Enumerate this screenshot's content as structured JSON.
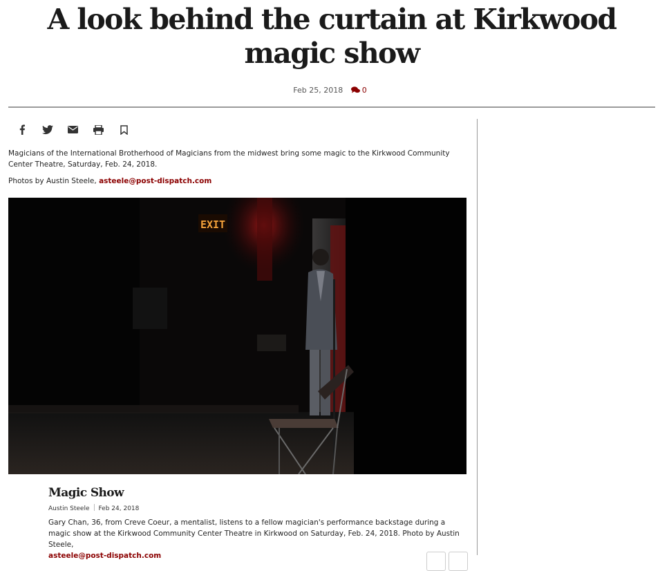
{
  "article": {
    "headline": "A look behind the curtain at Kirkwood magic show",
    "date": "Feb 25, 2018",
    "comment_count": "0",
    "intro": "Magicians of the International Brotherhood of Magicians from the midwest bring some magic to the Kirkwood Community Center Theatre, Saturday, Feb. 24, 2018.",
    "credit_prefix": "Photos by Austin Steele, ",
    "credit_email": "asteele@post-dispatch.com"
  },
  "share_icons": [
    "facebook-icon",
    "twitter-icon",
    "email-icon",
    "print-icon",
    "bookmark-icon"
  ],
  "photo": {
    "exit_sign": "EXIT"
  },
  "caption": {
    "title": "Magic Show",
    "author": "Austin Steele",
    "date": "Feb 24, 2018",
    "text": "Gary Chan, 36, from Creve Coeur, a mentalist, listens to a fellow magician's performance backstage during a magic show at the Kirkwood Community Center Theatre in Kirkwood on Saturday, Feb. 24, 2018. Photo by Austin Steele,",
    "email": "asteele@post-dispatch.com"
  },
  "colors": {
    "accent": "#8b0000",
    "text": "#222222",
    "rule": "#9a9a9a"
  }
}
